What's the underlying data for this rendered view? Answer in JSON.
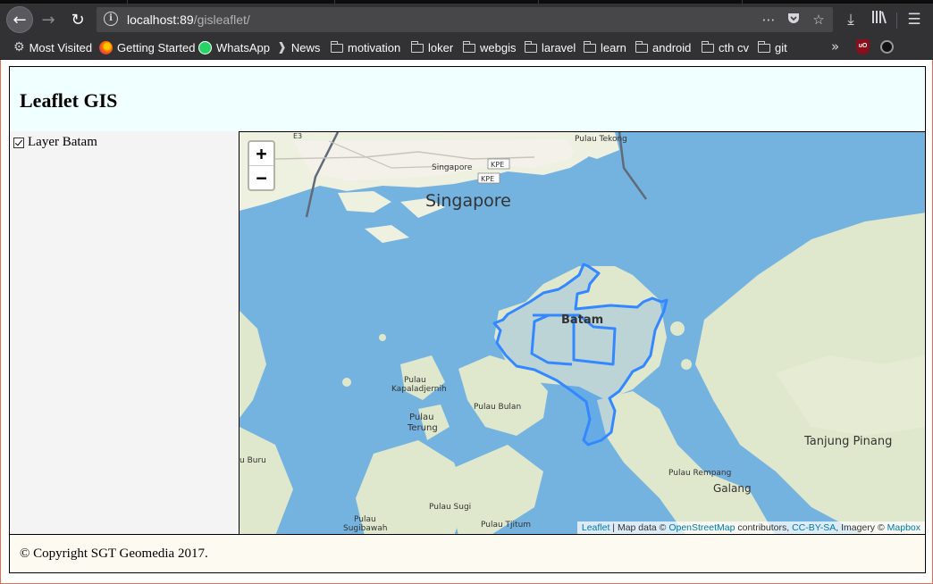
{
  "browser": {
    "url_host": "localhost:89",
    "url_path": "/gisleaflet/",
    "bookmarks": [
      "Most Visited",
      "Getting Started",
      "WhatsApp",
      "News",
      "motivation",
      "loker",
      "webgis",
      "laravel",
      "learn",
      "android",
      "cth cv",
      "git"
    ],
    "icons": {
      "back": "back-arrow-icon",
      "forward": "forward-arrow-icon",
      "reload": "reload-icon",
      "info": "info-icon",
      "page_actions": "more-dots-icon",
      "pocket": "pocket-icon",
      "bookmark_star": "star-icon",
      "downloads": "download-icon",
      "library": "library-icon",
      "menu": "hamburger-menu-icon"
    }
  },
  "page": {
    "title": "Leaflet GIS",
    "layers": [
      {
        "label": "Layer Batam",
        "checked": true
      }
    ],
    "footer": "© Copyright SGT Geomedia 2017."
  },
  "map": {
    "zoom_in": "+",
    "zoom_out": "−",
    "labels": {
      "singapore": "Singapore",
      "batam": "Batam",
      "tanjung_pinang": "Tanjung Pinang",
      "galang": "Galang",
      "pulau_rempang": "Pulau Rempang",
      "pulau_bulan": "Pulau Bulan",
      "pulau_terung_1": "Pulau",
      "pulau_terung_2": "Terung",
      "pulau_kapal_1": "Pulau",
      "pulau_kapal_2": "Kapaladjernih",
      "pulau_tekong": "Pulau Tekong",
      "pulau_sugi": "Pulau Sugi",
      "pulau_tjitum": "Pulau Tjitum",
      "pulau_sugibawah_1": "Pulau",
      "pulau_sugibawah_2": "Sugibawah",
      "buru": "u Buru",
      "singapore_small": "Singapore",
      "kpe1": "KPE",
      "kpe2": "KPE",
      "e3": "E3"
    },
    "attribution": {
      "leaflet": "Leaflet",
      "text1": " | Map data © ",
      "osm": "OpenStreetMap",
      "text2": " contributors, ",
      "license": "CC-BY-SA",
      "text3": ", Imagery © ",
      "mapbox": "Mapbox"
    },
    "colors": {
      "water": "#74b3e0",
      "land": "#eef0e0",
      "land_green": "#dfe8cc",
      "polygon_stroke": "#3388ff"
    }
  }
}
